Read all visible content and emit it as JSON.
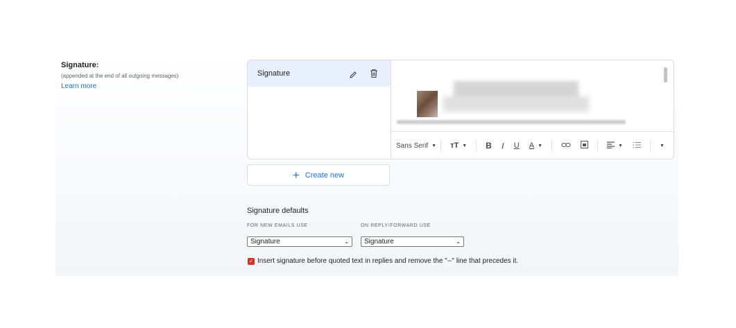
{
  "signature_section": {
    "title": "Signature:",
    "subtitle": "(appended at the end of all outgoing messages)",
    "learn_more": "Learn more"
  },
  "signature_list": {
    "items": [
      {
        "label": "Signature"
      }
    ]
  },
  "toolbar": {
    "font_family": "Sans Serif",
    "font_size_glyph": "тТ",
    "bold": "B",
    "italic": "I",
    "underline": "U",
    "text_color": "A",
    "tools": [
      "font-size-icon",
      "bold-icon",
      "italic-icon",
      "underline-icon",
      "text-color-icon",
      "link-icon",
      "image-icon",
      "align-icon",
      "numbered-list-icon",
      "more-icon"
    ]
  },
  "create_new": {
    "label": "Create new"
  },
  "defaults": {
    "title": "Signature defaults",
    "new_emails_label": "FOR NEW EMAILS USE",
    "reply_label": "ON REPLY/FORWARD USE",
    "new_emails_value": "Signature",
    "reply_value": "Signature"
  },
  "insert_option": {
    "checked": true,
    "label": "Insert signature before quoted text in replies and remove the \"--\" line that precedes it."
  },
  "colors": {
    "accent": "#1a73e8",
    "selected_item_bg": "#e8f0fe",
    "checkbox": "#d93025"
  }
}
